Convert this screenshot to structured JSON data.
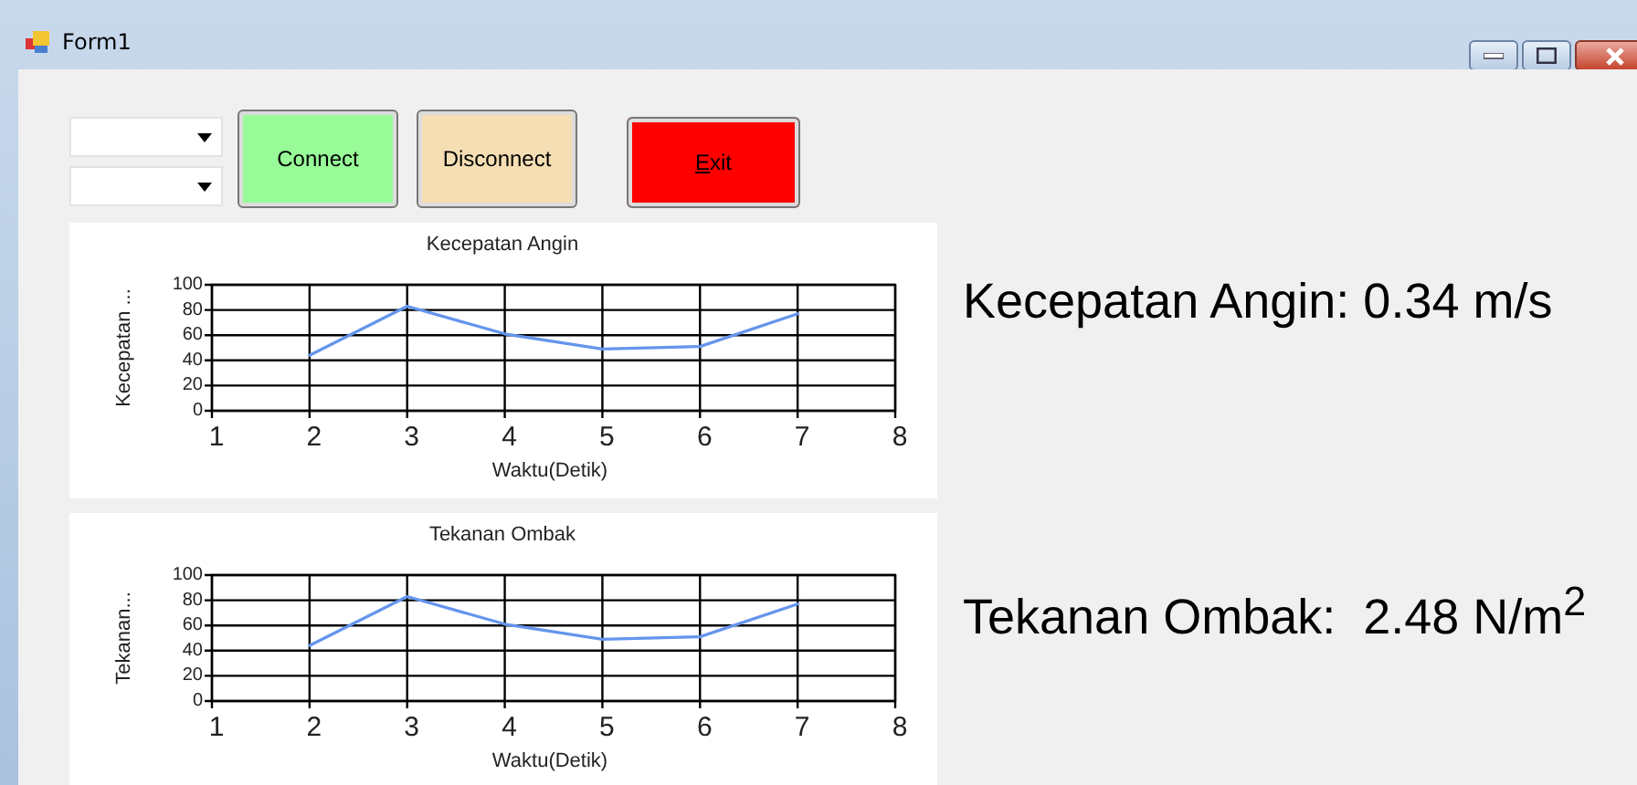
{
  "window": {
    "title": "Form1"
  },
  "dropdowns": [
    {
      "kind": "combo"
    },
    {
      "kind": "combo"
    }
  ],
  "buttons": [
    {
      "label": "Connect",
      "color": "#98fb98",
      "access_key_underlined": false
    },
    {
      "label": "Disconnect",
      "color": "#f5deb3",
      "access_key_underlined": false
    },
    {
      "label": "Exit",
      "color": "#ff0000",
      "access_key_underlined": true
    }
  ],
  "charts": [
    {
      "chart_data": {
        "type": "line",
        "title": "Kecepatan Angin",
        "xlabel": "Waktu(Detik)",
        "ylabel": "Kecepatan ...",
        "x": [
          2,
          3,
          4,
          5,
          6,
          7
        ],
        "series": [
          {
            "color": "#6495ed",
            "values": [
              44,
              83,
              61,
              49,
              51,
              77
            ]
          }
        ],
        "xlim": [
          1,
          8
        ],
        "ylim": [
          0,
          100
        ],
        "xticks": [
          1,
          2,
          3,
          4,
          5,
          6,
          7,
          8
        ],
        "yticks": [
          0,
          20,
          40,
          60,
          80,
          100
        ],
        "grid": true
      }
    },
    {
      "chart_data": {
        "type": "line",
        "title": "Tekanan Ombak",
        "xlabel": "Waktu(Detik)",
        "ylabel": "Tekanan...",
        "x": [
          2,
          3,
          4,
          5,
          6,
          7
        ],
        "series": [
          {
            "color": "#6495ed",
            "values": [
              44,
              83,
              61,
              49,
              51,
              77
            ]
          }
        ],
        "xlim": [
          1,
          8
        ],
        "ylim": [
          0,
          100
        ],
        "xticks": [
          1,
          2,
          3,
          4,
          5,
          6,
          7,
          8
        ],
        "yticks": [
          0,
          20,
          40,
          60,
          80,
          100
        ],
        "grid": true
      }
    }
  ],
  "readings": [
    "Kecepatan Angin: 0.34 m/s",
    "Tekanan Ombak:  2.48 N/m$^{2}$"
  ]
}
